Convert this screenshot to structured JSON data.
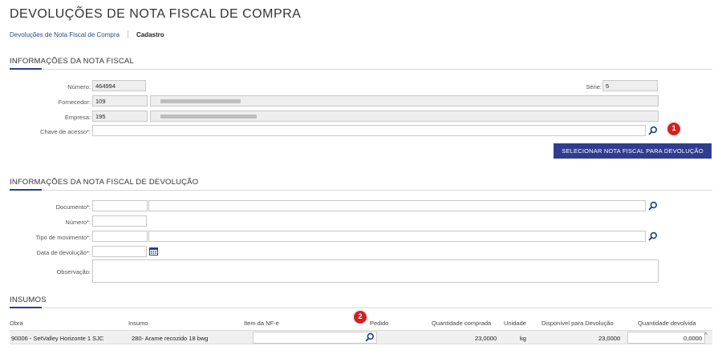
{
  "header": {
    "title": "DEVOLUÇÕES DE NOTA FISCAL DE COMPRA",
    "breadcrumb_link": "Devoluções de Nota Fiscal de Compra",
    "breadcrumb_current": "Cadastro"
  },
  "nota_fiscal": {
    "section_title": "INFORMAÇÕES DA NOTA FISCAL",
    "numero_label": "Número:",
    "numero_value": "464994",
    "serie_label": "Série:",
    "serie_value": "5",
    "fornecedor_label": "Fornecedor:",
    "fornecedor_code": "109",
    "empresa_label": "Empresa:",
    "empresa_code": "195",
    "chave_label": "Chave de acesso*:",
    "chave_value": "",
    "select_button": "SELECIONAR NOTA FISCAL PARA DEVOLUÇÃO",
    "badge_1": "1"
  },
  "devolucao": {
    "section_title": "INFORMAÇÕES DA NOTA FISCAL DE DEVOLUÇÃO",
    "documento_label": "Documento*:",
    "numero_label": "Número*:",
    "tipo_label": "Tipo de movimento*:",
    "data_label": "Data de devolução*:",
    "observacao_label": "Observação:"
  },
  "insumos": {
    "section_title": "INSUMOS",
    "badge_2": "2",
    "columns": {
      "obra": "Obra",
      "insumo": "Insumo",
      "item_nfe": "Item da NF-e",
      "pedido": "Pedido",
      "qtd_comprada": "Quantidade comprada",
      "unidade": "Unidade",
      "disponivel": "Disponível para Devolução",
      "qtd_devolvida": "Quantidade devolvida"
    },
    "rows": [
      {
        "obra": "90006 - SetValley Horizonte 1 SJC",
        "insumo": "280- Arame recozido 18 bwg",
        "item_nfe": "",
        "pedido": "",
        "qtd_comprada": "23,0000",
        "unidade": "kg",
        "disponivel": "23,0000",
        "qtd_devolvida": "0,0000"
      }
    ]
  },
  "colors": {
    "accent": "#2f3d8f",
    "badge": "#d42020",
    "icon": "#1f3d8f"
  },
  "icons": [
    "search-icon",
    "calendar-icon"
  ]
}
